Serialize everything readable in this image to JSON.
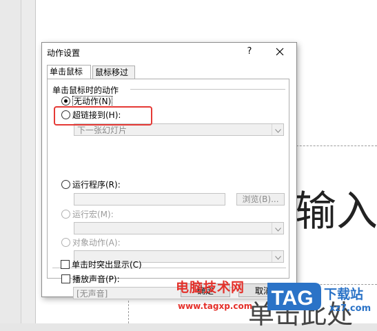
{
  "dialog": {
    "title": "动作设置",
    "help_label": "?",
    "tabs": [
      {
        "label": "单击鼠标",
        "active": true
      },
      {
        "label": "鼠标移过",
        "active": false
      }
    ],
    "group_label": "单击鼠标时的动作",
    "options": {
      "none": {
        "label": "无动作(N)",
        "checked": true
      },
      "hyperlink": {
        "label": "超链接到(H):",
        "checked": false,
        "value": "下一张幻灯片"
      },
      "run_program": {
        "label": "运行程序(R):",
        "checked": false,
        "value": "",
        "browse_label": "浏览(B)..."
      },
      "run_macro": {
        "label": "运行宏(M):",
        "checked": false,
        "enabled": false
      },
      "object_action": {
        "label": "对象动作(A):",
        "checked": false,
        "enabled": false
      }
    },
    "play_sound": {
      "label": "播放声音(P):",
      "checked": false,
      "value": "[无声音]"
    },
    "highlight_click": {
      "label": "单击时突出显示(C)",
      "checked": false
    },
    "ok_label": "确定",
    "cancel_label": "取消"
  },
  "slide": {
    "text_main": "输入",
    "text_bottom": "单击此处"
  },
  "watermark": {
    "text_cn": "电脑技术网",
    "url": "www.tagxp.com",
    "logo": "TAG",
    "site": "下载站",
    "site_url": "xz7.com"
  },
  "colors": {
    "highlight_border": "#e53935",
    "watermark_red": "#e4312b",
    "watermark_blue": "#2b73c7"
  }
}
